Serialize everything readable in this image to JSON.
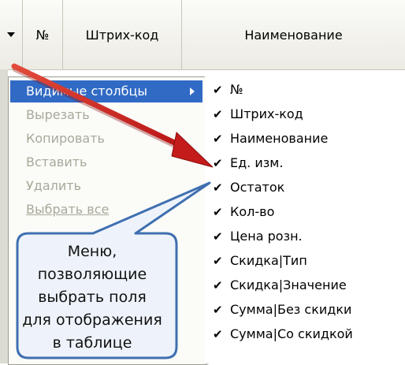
{
  "grid": {
    "columns": [
      "№",
      "Штрих-код",
      "Наименование"
    ]
  },
  "context_menu": {
    "items": [
      {
        "label": "Видимые столбцы",
        "state": "active",
        "has_submenu": true
      },
      {
        "label": "Вырезать",
        "state": "disabled"
      },
      {
        "label": "Копировать",
        "state": "disabled"
      },
      {
        "label": "Вставить",
        "state": "disabled"
      },
      {
        "label": "Удалить",
        "state": "disabled"
      },
      {
        "label": "Выбрать все",
        "state": "disabled"
      }
    ]
  },
  "submenu": {
    "items": [
      {
        "label": "№",
        "checked": true
      },
      {
        "label": "Штрих-код",
        "checked": true
      },
      {
        "label": "Наименование",
        "checked": true
      },
      {
        "label": "Ед. изм.",
        "checked": true
      },
      {
        "label": "Остаток",
        "checked": true
      },
      {
        "label": "Кол-во",
        "checked": true
      },
      {
        "label": "Цена розн.",
        "checked": true
      },
      {
        "label": "Скидка|Тип",
        "checked": true
      },
      {
        "label": "Скидка|Значение",
        "checked": true
      },
      {
        "label": "Сумма|Без скидки",
        "checked": true
      },
      {
        "label": "Сумма|Со скидкой",
        "checked": true
      }
    ]
  },
  "callout": {
    "lines": [
      "Меню,",
      "позволяющие",
      "выбрать поля",
      "для отображения",
      "в таблице"
    ]
  },
  "colors": {
    "highlight": "#316ac5",
    "arrow": "#d62020",
    "callout_border": "#3f6fb0",
    "callout_fill": "#eef3fb"
  }
}
